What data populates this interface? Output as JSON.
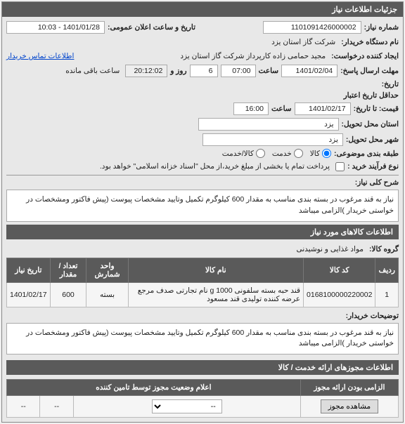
{
  "header": {
    "title": "جزئیات اطلاعات نیاز"
  },
  "fields": {
    "need_no_label": "شماره نیاز:",
    "need_no": "1101091426000002",
    "public_datetime_label": "تاریخ و ساعت اعلان عمومی:",
    "public_datetime": "1401/01/28 - 10:03",
    "buyer_org_label": "نام دستگاه خریدار:",
    "buyer_org": "شرکت گاز استان یزد",
    "requester_label": "ایجاد کننده درخواست:",
    "requester": "مجید حمامی زاده کارپرداز شرکت گاز استان یزد",
    "contact_link": "اطلاعات تماس خریدار",
    "deadline_label": "مهلت ارسال پاسخ:",
    "deadline_date": "1401/02/04",
    "time_label": "ساعت",
    "deadline_time": "07:00",
    "day_label": "روز و",
    "days": "6",
    "remain_time": "20:12:02",
    "remain_suffix": "ساعت باقی مانده",
    "history_label": "تاریخ:",
    "valid_from_label": "حداقل تاریخ اعتبار",
    "valid_to_label": "قیمت: تا تاریخ:",
    "valid_to_date": "1401/02/17",
    "valid_to_time": "16:00",
    "loc_need_label": "استان محل تحویل:",
    "loc_need": "یزد",
    "loc_city_label": "شهر محل تحویل:",
    "loc_city": "یزد",
    "category_label": "طبقه بندی موضوعی:",
    "cat_goods": "کالا",
    "cat_service": "خدمت",
    "cat_goods_service": "کالا/خدمت",
    "purchase_type_label": "نوع فرآیند خرید :",
    "purchase_type_note": "پرداخت تمام یا بخشی از مبلغ خرید،از محل \"اسناد خزانه اسلامی\" خواهد بود."
  },
  "desc": {
    "label": "شرح کلی نیاز:",
    "text": "نیاز به قند مرغوب در بسته بندی مناسب به مقدار 600 کیلوگرم تکمیل وتایید مشخصات پیوست (پیش فاکتور ومشخصات در خواستی خریدار )الزامی میباشد"
  },
  "items_section": {
    "title": "اطلاعات کالاهای مورد نیاز",
    "group_label": "گروه کالا:",
    "group_value": "مواد غذایی و نوشیدنی"
  },
  "table": {
    "headers": {
      "row": "ردیف",
      "code": "کد کالا",
      "name": "نام کالا",
      "unit": "واحد شمارش",
      "qty": "تعداد / مقدار",
      "date": "تاریخ نیاز"
    },
    "rows": [
      {
        "row": "1",
        "code": "0168100000220002",
        "name": "قند حبه بسته سلفونی 1000 g نام تجارتی صدف مرجع عرضه کننده تولیدی قند مسعود",
        "unit": "بسته",
        "qty": "600",
        "date": "1401/02/17"
      }
    ]
  },
  "buyer_notes": {
    "label": "توضیحات خریدار:",
    "text": "نیاز به قند مرغوب در بسته بندی مناسب به مقدار 600 کیلوگرم تکمیل وتایید مشخصات پیوست (پیش فاکتور ومشخصات در خواستی خریدار )الزامی میباشد"
  },
  "permits": {
    "section_title": "اطلاعات مجوزهای ارائه خدمت / کالا",
    "mandatory_label": "الزامی بودن ارائه مجوز",
    "status_header": "اعلام وضعیت مجوز توسط تامین کننده",
    "view_btn": "مشاهده مجوز",
    "select_placeholder": "--",
    "dash": "--"
  }
}
